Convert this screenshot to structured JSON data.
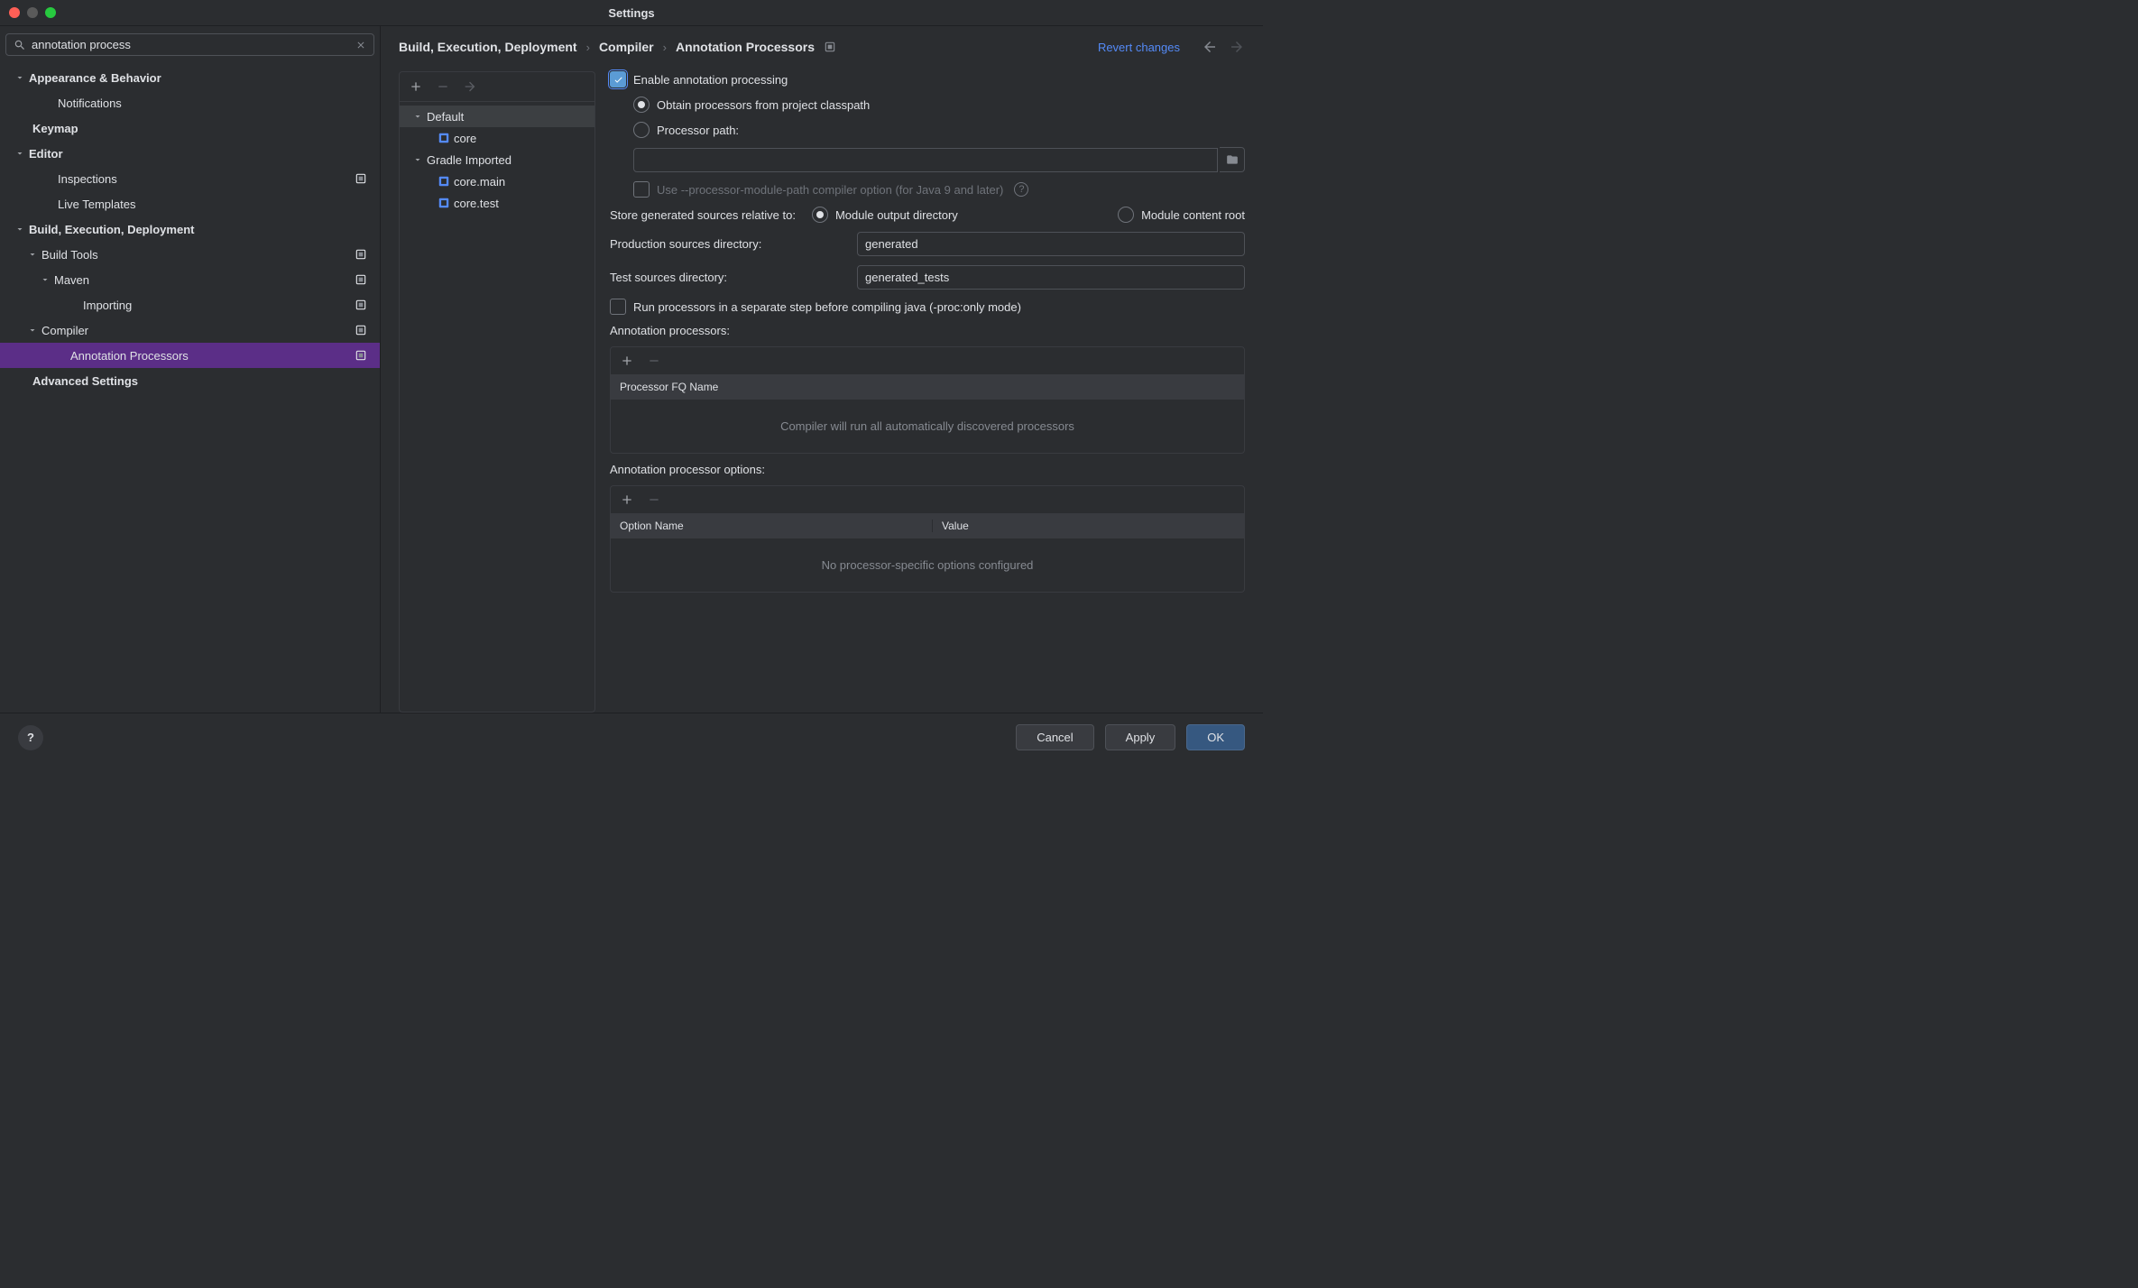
{
  "window": {
    "title": "Settings"
  },
  "search": {
    "value": "annotation process"
  },
  "sidebar": {
    "items": [
      {
        "label": "Appearance & Behavior",
        "bold": true,
        "chevron": true,
        "indent": 0
      },
      {
        "label": "Notifications",
        "indent": 2
      },
      {
        "label": "Keymap",
        "bold": true,
        "indent": 0
      },
      {
        "label": "Editor",
        "bold": true,
        "chevron": true,
        "indent": 0
      },
      {
        "label": "Inspections",
        "indent": 2,
        "config": true
      },
      {
        "label": "Live Templates",
        "indent": 2
      },
      {
        "label": "Build, Execution, Deployment",
        "bold": true,
        "chevron": true,
        "indent": 0
      },
      {
        "label": "Build Tools",
        "chevron": true,
        "indent": 1,
        "config": true
      },
      {
        "label": "Maven",
        "chevron": true,
        "indent": 2,
        "config": true
      },
      {
        "label": "Importing",
        "indent": 4,
        "config": true
      },
      {
        "label": "Compiler",
        "chevron": true,
        "indent": 1,
        "config": true
      },
      {
        "label": "Annotation Processors",
        "indent": 3,
        "config": true,
        "selected": true
      },
      {
        "label": "Advanced Settings",
        "bold": true,
        "indent": 0
      }
    ]
  },
  "breadcrumb": {
    "parts": [
      "Build, Execution, Deployment",
      "Compiler",
      "Annotation Processors"
    ]
  },
  "header": {
    "revert": "Revert changes"
  },
  "profiles": {
    "items": [
      {
        "label": "Default",
        "chevron": true,
        "indent": 0,
        "selected": true
      },
      {
        "label": "core",
        "indent": 2,
        "mod": true
      },
      {
        "label": "Gradle Imported",
        "chevron": true,
        "indent": 0
      },
      {
        "label": "core.main",
        "indent": 2,
        "mod": true
      },
      {
        "label": "core.test",
        "indent": 2,
        "mod": true
      }
    ]
  },
  "form": {
    "enable_label": "Enable annotation processing",
    "obtain_label": "Obtain processors from project classpath",
    "path_label": "Processor path:",
    "use_module_path_label": "Use --processor-module-path compiler option (for Java 9 and later)",
    "store_label": "Store generated sources relative to:",
    "module_output_label": "Module output directory",
    "module_content_label": "Module content root",
    "prod_dir_label": "Production sources directory:",
    "prod_dir_value": "generated",
    "test_dir_label": "Test sources directory:",
    "test_dir_value": "generated_tests",
    "run_sep_label": "Run processors in a separate step before compiling java (-proc:only mode)",
    "ann_proc_label": "Annotation processors:",
    "fq_name_col": "Processor FQ Name",
    "fq_empty": "Compiler will run all automatically discovered processors",
    "opt_label": "Annotation processor options:",
    "opt_col1": "Option Name",
    "opt_col2": "Value",
    "opt_empty": "No processor-specific options configured"
  },
  "footer": {
    "cancel": "Cancel",
    "apply": "Apply",
    "ok": "OK"
  }
}
